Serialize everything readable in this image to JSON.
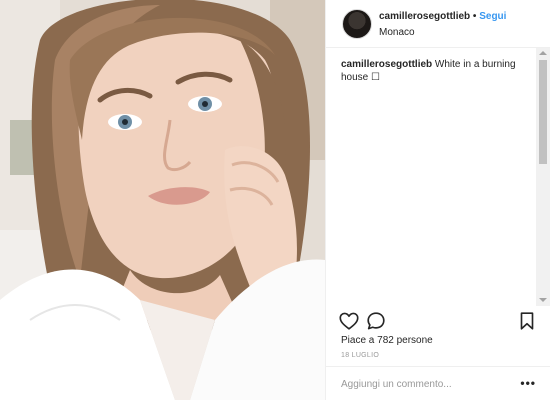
{
  "post": {
    "username": "camillerosegottlieb",
    "separator": "•",
    "follow_label": "Segui",
    "location": "Monaco",
    "caption": {
      "username": "camillerosegottlieb",
      "text": "White in a burning house ☐"
    },
    "likes_text": "Piace a 782 persone",
    "date": "18 LUGLIO",
    "comment_placeholder": "Aggiungi un commento...",
    "more_label": "•••"
  },
  "icons": {
    "like": "heart-icon",
    "comment": "comment-bubble-icon",
    "save": "bookmark-icon",
    "more": "more-options-icon"
  },
  "colors": {
    "link": "#3897f0",
    "text": "#262626",
    "muted": "#999999",
    "border": "#efefef"
  }
}
